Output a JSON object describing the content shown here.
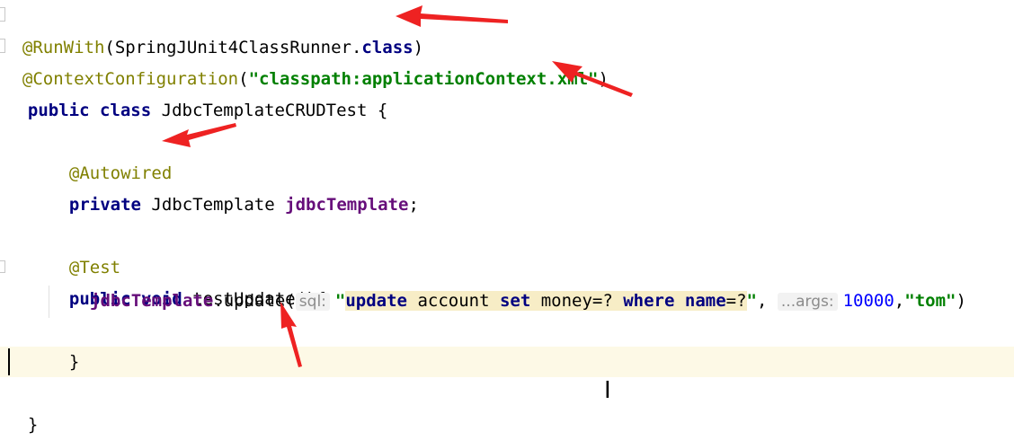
{
  "code": {
    "line1": {
      "annotation": "@RunWith",
      "open": "(SpringJUnit4ClassRunner.",
      "kw": "class",
      "close": ")"
    },
    "line2": {
      "annotation": "@ContextConfiguration",
      "open": "(",
      "string": "\"classpath:applicationContext.xml\"",
      "close": ")"
    },
    "line3": {
      "kw1": "public",
      "kw2": "class",
      "name": "JdbcTemplateCRUDTest {"
    },
    "line4": {
      "annotation": "@Autowired"
    },
    "line5": {
      "kw": "private",
      "type": "JdbcTemplate",
      "field": "jdbcTemplate",
      "semi": ";"
    },
    "line6": {
      "annotation": "@Test"
    },
    "line7": {
      "kw1": "public",
      "kw2": "void",
      "method": "testUpdate(){"
    },
    "line8": {
      "field": "jdbcTemplate",
      "call": ".update(",
      "hint_sql": "sql:",
      "quote_open": "\"",
      "sql_update": "update",
      "sql_account": " account ",
      "sql_set": "set",
      "sql_money": " money=? ",
      "sql_where": "where",
      "sql_name": " name",
      "sql_tail": "=?",
      "quote_close": "\"",
      "comma": ",",
      "hint_args": "...args:",
      "num": "10000",
      "comma2": ",",
      "str_tom": "\"tom\"",
      "close": ")"
    },
    "line9": {
      "brace": "}"
    },
    "line11": {
      "brace": "}"
    }
  },
  "colors": {
    "annotation": "#808000",
    "keyword": "#000080",
    "string": "#008000",
    "field": "#660e7a",
    "number": "#0000ff",
    "arrow": "#ee2222",
    "current_line": "#fdf9e6"
  }
}
